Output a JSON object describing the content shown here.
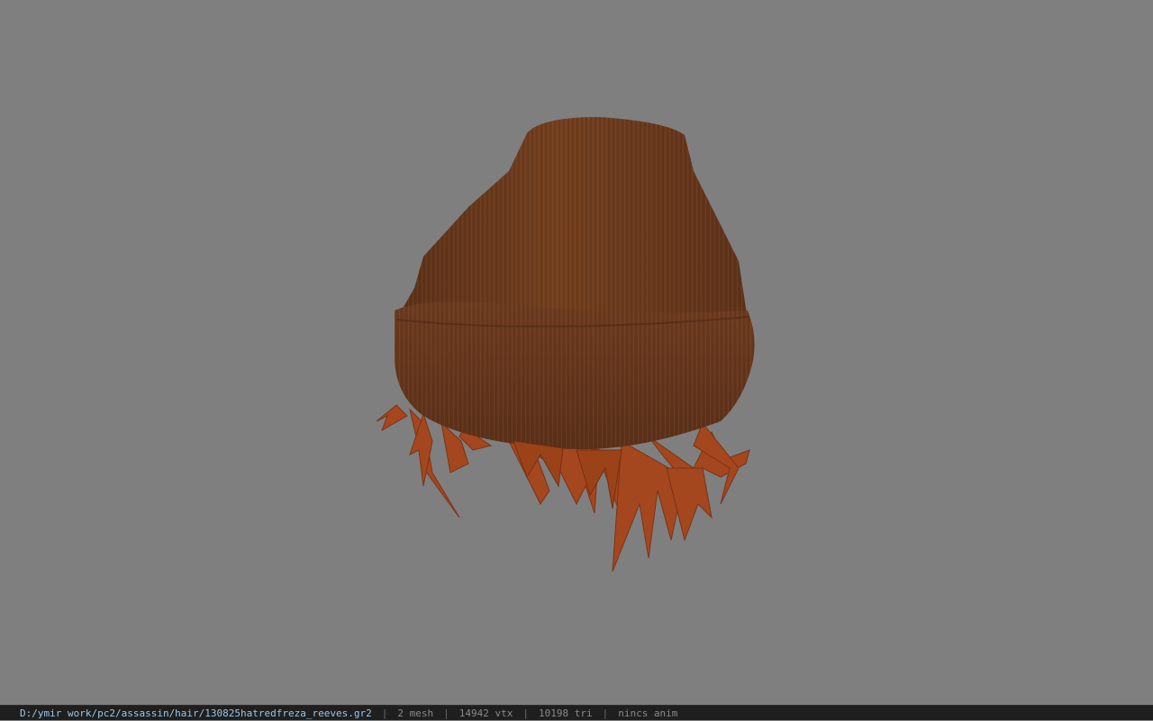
{
  "viewport": {
    "background_color": "#7f7f7f",
    "model": {
      "subject": "beanie-hat-with-hair",
      "hat_color": "#6b3a20",
      "hair_color": "#a4471e"
    }
  },
  "statusbar": {
    "file_path": "D:/ymir work/pc2/assassin/hair/130825hatredfreza_reeves.gr2",
    "separator": "|",
    "mesh_count": "2 mesh",
    "vertex_count": "14942 vtx",
    "triangle_count": "10198 tri",
    "anim_info": "nincs anim"
  }
}
